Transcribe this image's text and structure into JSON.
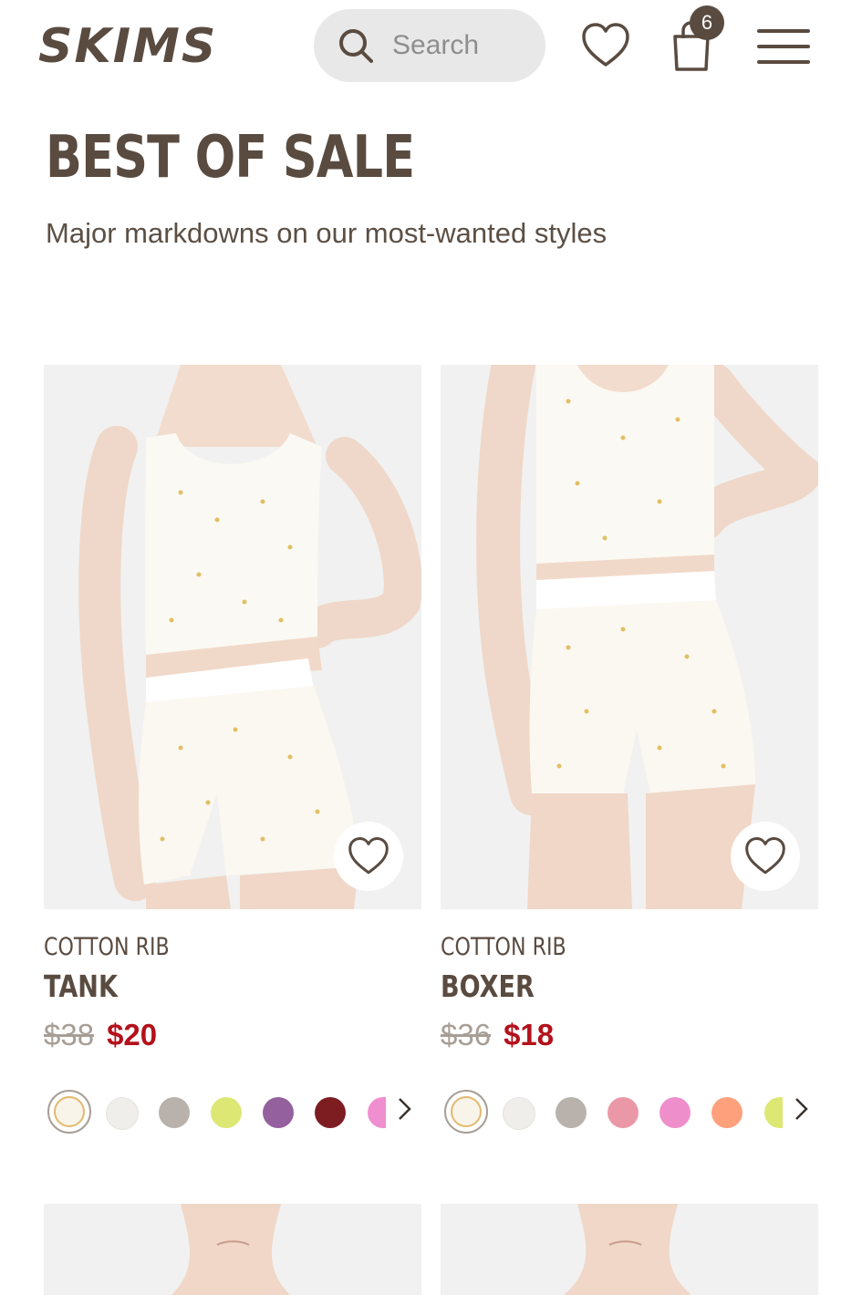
{
  "header": {
    "logo_text": "SKIMS",
    "search_placeholder": "Search",
    "cart_count": "6"
  },
  "page": {
    "title": "BEST OF SALE",
    "subtitle": "Major markdowns on our most-wanted styles"
  },
  "products": [
    {
      "collection": "COTTON RIB",
      "name": "TANK",
      "original_price": "$38",
      "sale_price": "$20",
      "swatches": [
        "#ffffff",
        "#efeeea",
        "#b9b2ac",
        "#dde774",
        "#94609e",
        "#7d1d22",
        "#ef8fd0"
      ]
    },
    {
      "collection": "COTTON RIB",
      "name": "BOXER",
      "original_price": "$36",
      "sale_price": "$18",
      "swatches": [
        "#ffffff",
        "#efeeea",
        "#b9b2ac",
        "#ea98a8",
        "#ee8fcc",
        "#ffa07d",
        "#dde774"
      ]
    }
  ],
  "icons": {
    "search": "search-icon",
    "wishlist": "heart-icon",
    "cart": "shopping-bag-icon",
    "menu": "hamburger-menu-icon",
    "favorite": "heart-icon",
    "more_swatches": "chevron-right-icon"
  },
  "colors": {
    "brand_text": "#5a4b40",
    "sale_red": "#b3111b",
    "search_bg": "#e8e8e8",
    "image_bg": "#f1f1f1"
  }
}
